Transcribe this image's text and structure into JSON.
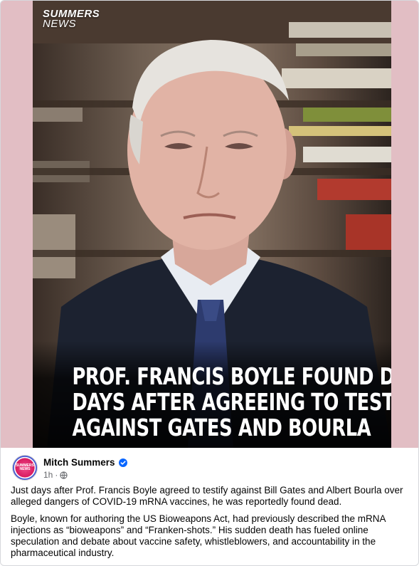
{
  "media": {
    "watermark": {
      "line1": "SUMMERS",
      "line2": "NEWS"
    },
    "headline_lines": [
      "PROF. FRANCIS BOYLE FOUND DEAD",
      "DAYS AFTER AGREEING TO TESTIFY",
      "AGAINST GATES AND BOURLA"
    ]
  },
  "post": {
    "author": "Mitch Summers",
    "avatar_text": "SUMMERS NEWS",
    "time": "1h",
    "separator": "·",
    "icons": {
      "verified": "verified-badge-icon",
      "audience": "globe-icon"
    },
    "paragraphs": [
      "Just days after Prof. Francis Boyle agreed to testify against Bill Gates and Albert Bourla over alleged dangers of COVID-19 mRNA vaccines, he was reportedly found dead.",
      "Boyle, known for authoring the US Bioweapons Act, had previously described the mRNA injections as “bioweapons” and “Franken-shots.” His sudden death has fueled online speculation and debate about vaccine safety, whistleblowers, and accountability in the pharmaceutical industry."
    ]
  },
  "colors": {
    "frame_pink": "#e2bec4",
    "verified_blue": "#0866ff",
    "meta_gray": "#65676b"
  }
}
